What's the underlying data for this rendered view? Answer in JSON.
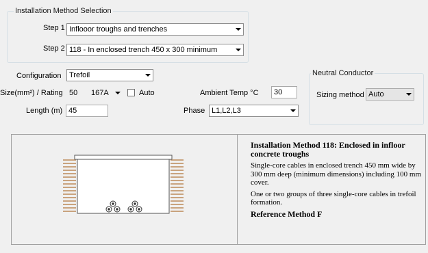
{
  "installation": {
    "group_title": "Installation Method Selection",
    "step1_label": "Step 1",
    "step1_value": "Inflooor troughs and trenches",
    "step2_label": "Step 2",
    "step2_value": "118 - In enclosed trench 450 x 300 minimum"
  },
  "cable": {
    "configuration_label": "Configuration",
    "configuration_value": "Trefoil",
    "size_label": "Size(mm²) / Rating",
    "size_value": "50",
    "rating_value": "167A",
    "auto_label": "Auto",
    "auto_checked": false,
    "ambient_label": "Ambient Temp °C",
    "ambient_value": "30",
    "length_label": "Length (m)",
    "length_value": "45",
    "phase_label": "Phase",
    "phase_value": "L1,L2,L3"
  },
  "neutral": {
    "group_title": "Neutral Conductor",
    "sizing_label": "Sizing method",
    "sizing_value": "Auto"
  },
  "description": {
    "title": "Installation Method 118: Enclosed in infloor concrete troughs",
    "para1": "Single-core cables in enclosed trench 450 mm wide by 300 mm deep (minimum dimensions) including 100 mm cover.",
    "para2": "One or two groups of three single-core cables in trefoil formation.",
    "reference": "Reference Method F"
  },
  "colors": {
    "ground_stripe": "#c9a37e",
    "cable_outline": "#333333",
    "group_border": "#d5dfe5"
  },
  "icons": {
    "dropdown": "chevron-down-icon",
    "cable": "trefoil-cable-icon"
  }
}
